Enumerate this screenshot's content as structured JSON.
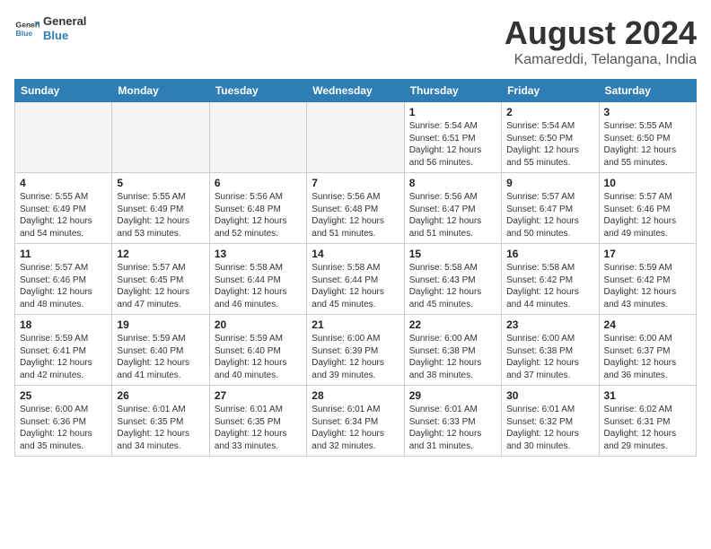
{
  "logo": {
    "line1": "General",
    "line2": "Blue"
  },
  "title": "August 2024",
  "subtitle": "Kamareddi, Telangana, India",
  "weekdays": [
    "Sunday",
    "Monday",
    "Tuesday",
    "Wednesday",
    "Thursday",
    "Friday",
    "Saturday"
  ],
  "weeks": [
    [
      {
        "day": "",
        "info": ""
      },
      {
        "day": "",
        "info": ""
      },
      {
        "day": "",
        "info": ""
      },
      {
        "day": "",
        "info": ""
      },
      {
        "day": "1",
        "info": "Sunrise: 5:54 AM\nSunset: 6:51 PM\nDaylight: 12 hours\nand 56 minutes."
      },
      {
        "day": "2",
        "info": "Sunrise: 5:54 AM\nSunset: 6:50 PM\nDaylight: 12 hours\nand 55 minutes."
      },
      {
        "day": "3",
        "info": "Sunrise: 5:55 AM\nSunset: 6:50 PM\nDaylight: 12 hours\nand 55 minutes."
      }
    ],
    [
      {
        "day": "4",
        "info": "Sunrise: 5:55 AM\nSunset: 6:49 PM\nDaylight: 12 hours\nand 54 minutes."
      },
      {
        "day": "5",
        "info": "Sunrise: 5:55 AM\nSunset: 6:49 PM\nDaylight: 12 hours\nand 53 minutes."
      },
      {
        "day": "6",
        "info": "Sunrise: 5:56 AM\nSunset: 6:48 PM\nDaylight: 12 hours\nand 52 minutes."
      },
      {
        "day": "7",
        "info": "Sunrise: 5:56 AM\nSunset: 6:48 PM\nDaylight: 12 hours\nand 51 minutes."
      },
      {
        "day": "8",
        "info": "Sunrise: 5:56 AM\nSunset: 6:47 PM\nDaylight: 12 hours\nand 51 minutes."
      },
      {
        "day": "9",
        "info": "Sunrise: 5:57 AM\nSunset: 6:47 PM\nDaylight: 12 hours\nand 50 minutes."
      },
      {
        "day": "10",
        "info": "Sunrise: 5:57 AM\nSunset: 6:46 PM\nDaylight: 12 hours\nand 49 minutes."
      }
    ],
    [
      {
        "day": "11",
        "info": "Sunrise: 5:57 AM\nSunset: 6:46 PM\nDaylight: 12 hours\nand 48 minutes."
      },
      {
        "day": "12",
        "info": "Sunrise: 5:57 AM\nSunset: 6:45 PM\nDaylight: 12 hours\nand 47 minutes."
      },
      {
        "day": "13",
        "info": "Sunrise: 5:58 AM\nSunset: 6:44 PM\nDaylight: 12 hours\nand 46 minutes."
      },
      {
        "day": "14",
        "info": "Sunrise: 5:58 AM\nSunset: 6:44 PM\nDaylight: 12 hours\nand 45 minutes."
      },
      {
        "day": "15",
        "info": "Sunrise: 5:58 AM\nSunset: 6:43 PM\nDaylight: 12 hours\nand 45 minutes."
      },
      {
        "day": "16",
        "info": "Sunrise: 5:58 AM\nSunset: 6:42 PM\nDaylight: 12 hours\nand 44 minutes."
      },
      {
        "day": "17",
        "info": "Sunrise: 5:59 AM\nSunset: 6:42 PM\nDaylight: 12 hours\nand 43 minutes."
      }
    ],
    [
      {
        "day": "18",
        "info": "Sunrise: 5:59 AM\nSunset: 6:41 PM\nDaylight: 12 hours\nand 42 minutes."
      },
      {
        "day": "19",
        "info": "Sunrise: 5:59 AM\nSunset: 6:40 PM\nDaylight: 12 hours\nand 41 minutes."
      },
      {
        "day": "20",
        "info": "Sunrise: 5:59 AM\nSunset: 6:40 PM\nDaylight: 12 hours\nand 40 minutes."
      },
      {
        "day": "21",
        "info": "Sunrise: 6:00 AM\nSunset: 6:39 PM\nDaylight: 12 hours\nand 39 minutes."
      },
      {
        "day": "22",
        "info": "Sunrise: 6:00 AM\nSunset: 6:38 PM\nDaylight: 12 hours\nand 38 minutes."
      },
      {
        "day": "23",
        "info": "Sunrise: 6:00 AM\nSunset: 6:38 PM\nDaylight: 12 hours\nand 37 minutes."
      },
      {
        "day": "24",
        "info": "Sunrise: 6:00 AM\nSunset: 6:37 PM\nDaylight: 12 hours\nand 36 minutes."
      }
    ],
    [
      {
        "day": "25",
        "info": "Sunrise: 6:00 AM\nSunset: 6:36 PM\nDaylight: 12 hours\nand 35 minutes."
      },
      {
        "day": "26",
        "info": "Sunrise: 6:01 AM\nSunset: 6:35 PM\nDaylight: 12 hours\nand 34 minutes."
      },
      {
        "day": "27",
        "info": "Sunrise: 6:01 AM\nSunset: 6:35 PM\nDaylight: 12 hours\nand 33 minutes."
      },
      {
        "day": "28",
        "info": "Sunrise: 6:01 AM\nSunset: 6:34 PM\nDaylight: 12 hours\nand 32 minutes."
      },
      {
        "day": "29",
        "info": "Sunrise: 6:01 AM\nSunset: 6:33 PM\nDaylight: 12 hours\nand 31 minutes."
      },
      {
        "day": "30",
        "info": "Sunrise: 6:01 AM\nSunset: 6:32 PM\nDaylight: 12 hours\nand 30 minutes."
      },
      {
        "day": "31",
        "info": "Sunrise: 6:02 AM\nSunset: 6:31 PM\nDaylight: 12 hours\nand 29 minutes."
      }
    ]
  ]
}
